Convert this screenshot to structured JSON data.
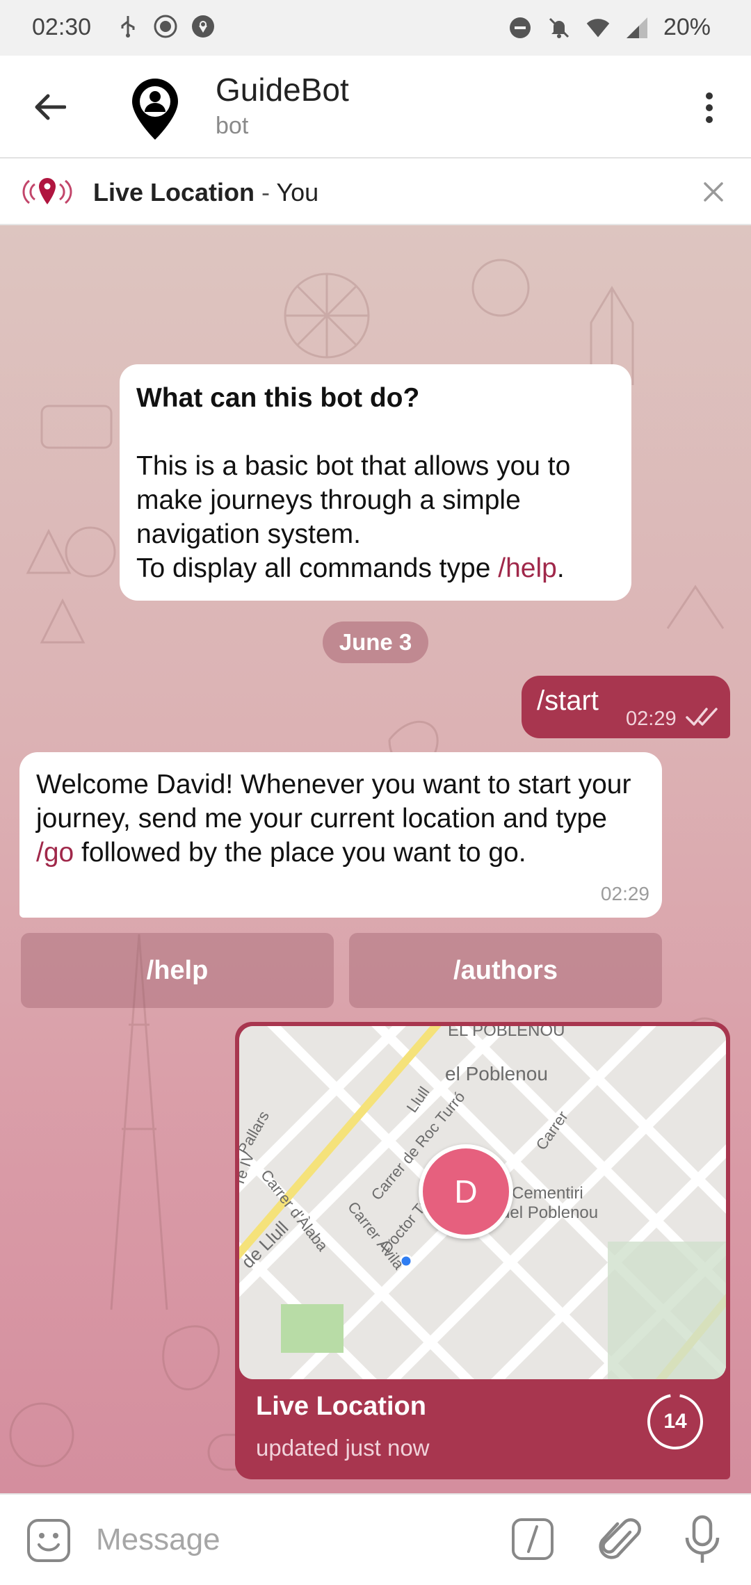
{
  "status_bar": {
    "time": "02:30",
    "battery": "20%"
  },
  "header": {
    "title": "GuideBot",
    "subtitle": "bot"
  },
  "live_bar": {
    "label": "Live Location",
    "separator": " - ",
    "who": "You"
  },
  "info_bubble": {
    "question": "What can this bot do?",
    "body": "This is a basic bot that allows you to make journeys through a simple navigation system.",
    "help_prefix": "To display all commands type ",
    "help_cmd": "/help",
    "help_suffix": "."
  },
  "date_label": "June 3",
  "outgoing": {
    "text": "/start",
    "time": "02:29"
  },
  "incoming": {
    "part1": "Welcome David! Whenever you want to start your journey, send me your current location and type ",
    "cmd": "/go",
    "part2": " followed by the place you want to go.",
    "time": "02:29"
  },
  "keyboard": {
    "btn1": "/help",
    "btn2": "/authors"
  },
  "location": {
    "title": "Live Location",
    "subtitle": "updated just now",
    "timer": "14",
    "avatar_letter": "D",
    "map_labels": [
      "EL POBLENOU",
      "el Poblenou",
      "Cementiri",
      "del Poblenou",
      "Carrer d'Àlaba",
      "Carrer Àvila",
      "Carrer de Roc Turró",
      "Doctor Trueta",
      "de Llull",
      "Pallars",
      "Carrer",
      "Llull",
      "re IV"
    ]
  },
  "input": {
    "placeholder": "Message"
  },
  "colors": {
    "accent": "#a8364f",
    "link": "#a0284a"
  }
}
